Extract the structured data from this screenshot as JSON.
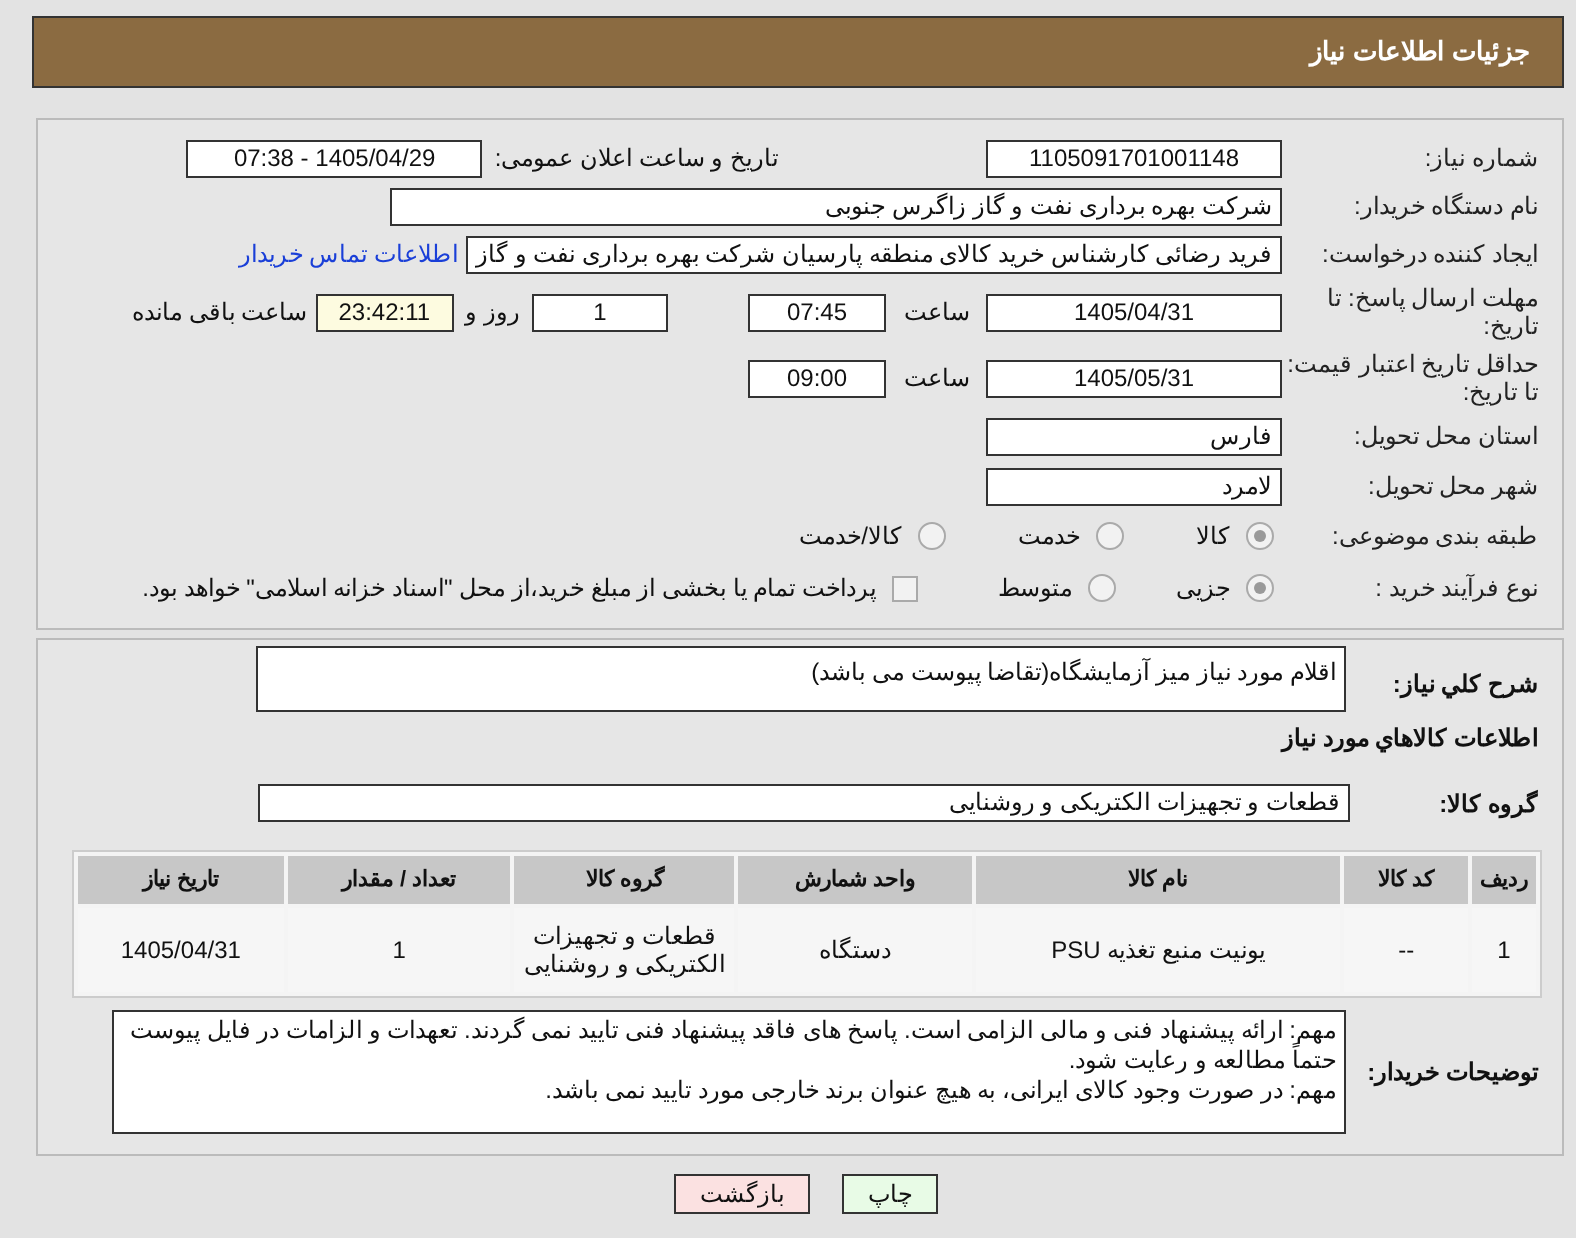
{
  "header": {
    "title": "جزئیات اطلاعات نیاز"
  },
  "info": {
    "need_number": {
      "label": "شماره نیاز:",
      "value": "1105091701001148"
    },
    "announce": {
      "label": "تاریخ و ساعت اعلان عمومی:",
      "value": "1405/04/29 - 07:38"
    },
    "buyer": {
      "label": "نام دستگاه خریدار:",
      "value": "شرکت بهره برداری نفت و گاز زاگرس جنوبی"
    },
    "creator": {
      "label": "ایجاد کننده درخواست:",
      "value": "فرید رضائی کارشناس خرید کالای منطقه پارسیان شرکت بهره برداری نفت و گاز",
      "link": "اطلاعات تماس خریدار"
    },
    "deadline": {
      "label": "مهلت ارسال پاسخ: تا تاریخ:",
      "date": "1405/04/31",
      "time_label": "ساعت",
      "time": "07:45",
      "days": "1",
      "days_label": "روز و",
      "remaining": "23:42:11",
      "remaining_label": "ساعت باقی مانده"
    },
    "validity": {
      "label": "حداقل تاریخ اعتبار قیمت: تا تاریخ:",
      "date": "1405/05/31",
      "time_label": "ساعت",
      "time": "09:00"
    },
    "province": {
      "label": "استان محل تحویل:",
      "value": "فارس"
    },
    "city": {
      "label": "شهر محل تحویل:",
      "value": "لامرد"
    },
    "category": {
      "label": "طبقه بندی موضوعی:",
      "options": [
        {
          "label": "کالا",
          "selected": true
        },
        {
          "label": "خدمت",
          "selected": false
        },
        {
          "label": "کالا/خدمت",
          "selected": false
        }
      ]
    },
    "process": {
      "label": "نوع فرآیند خرید :",
      "options": [
        {
          "label": "جزیی",
          "selected": true
        },
        {
          "label": "متوسط",
          "selected": false
        }
      ],
      "treasury": {
        "label": "پرداخت تمام یا بخشی از مبلغ خرید،از محل \"اسناد خزانه اسلامی\" خواهد بود.",
        "checked": false
      }
    }
  },
  "details": {
    "description": {
      "label": "شرح کلي نياز:",
      "value": "اقلام مورد نیاز میز آزمایشگاه(تقاضا پیوست می باشد)"
    },
    "items_heading": "اطلاعات كالاهاي مورد نياز",
    "group": {
      "label": "گروه کالا:",
      "value": "قطعات و تجهیزات الکتریکی و روشنایی"
    },
    "table": {
      "columns": [
        "ردیف",
        "کد کالا",
        "نام کالا",
        "واحد شمارش",
        "گروه کالا",
        "تعداد / مقدار",
        "تاریخ نیاز"
      ],
      "rows": [
        [
          "1",
          "--",
          "یونیت منبع تغذیه PSU",
          "دستگاه",
          "قطعات و تجهیزات الکتریکی و روشنایی",
          "1",
          "1405/04/31"
        ]
      ]
    },
    "notes": {
      "label": "توضیحات خریدار:",
      "lines": [
        "مهم: ارائه پیشنهاد فنی و مالی الزامی است. پاسخ های فاقد پیشنهاد فنی تایید نمی گردند. تعهدات و الزامات در فایل پیوست حتماً مطالعه و رعایت شود.",
        "مهم:  در صورت وجود کالای ایرانی، به هیچ عنوان برند خارجی مورد تایید نمی باشد."
      ]
    }
  },
  "buttons": [
    {
      "label": "چاپ",
      "kind": "print"
    },
    {
      "label": "بازگشت",
      "kind": "back"
    }
  ]
}
